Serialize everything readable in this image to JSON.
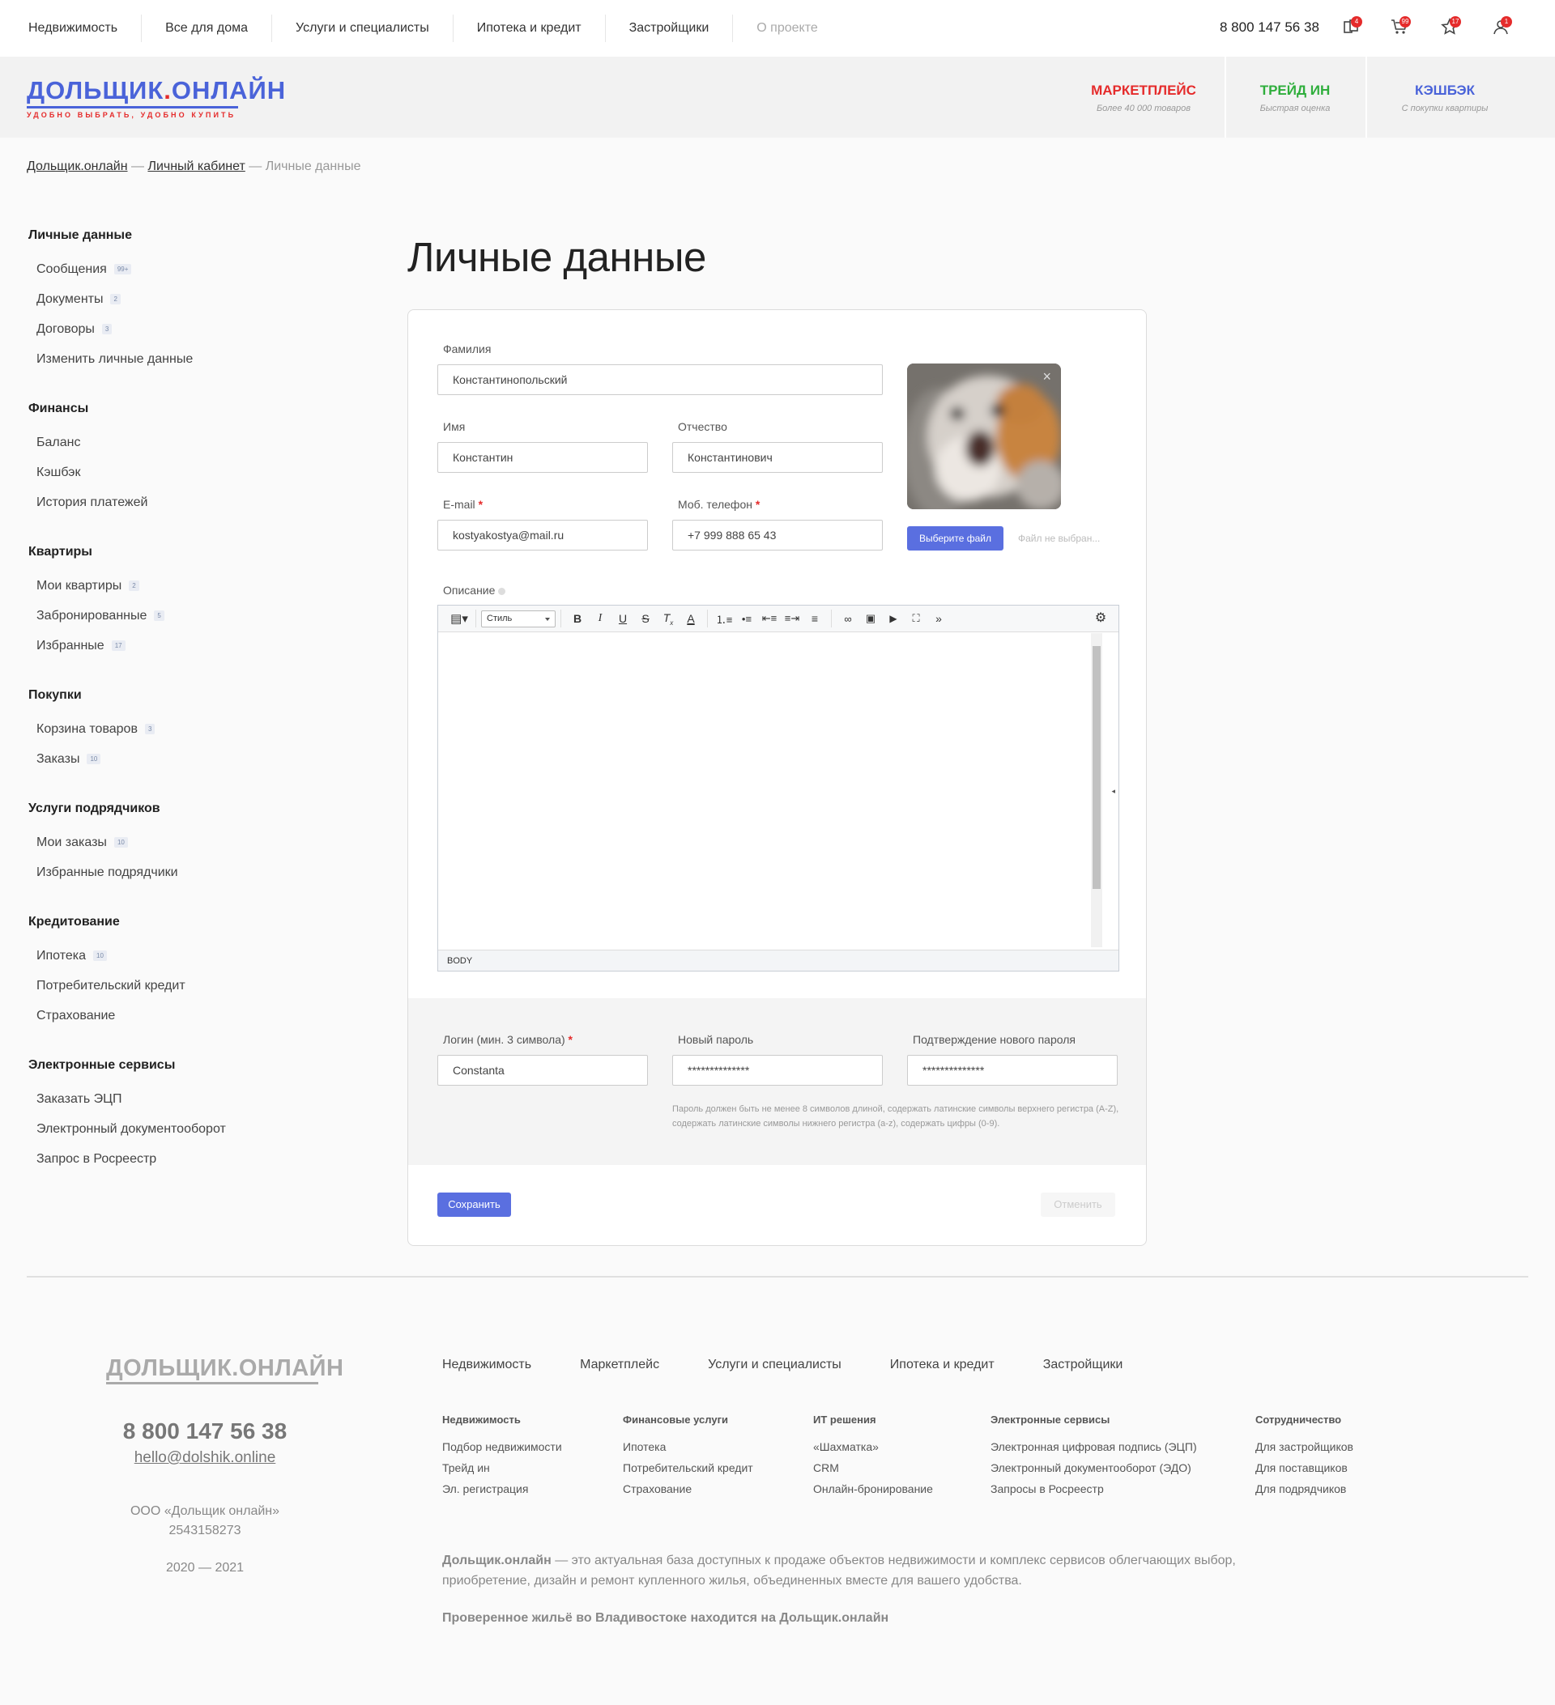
{
  "topbar": {
    "nav": [
      "Недвижимость",
      "Все для дома",
      "Услуги и специалисты",
      "Ипотека и кредит",
      "Застройщики",
      "О проекте"
    ],
    "phone": "8 800 147 56 38",
    "badges": {
      "compare": "4",
      "cart": "99",
      "favorites": "17",
      "account": "1"
    }
  },
  "header": {
    "logo_main_left": "ДОЛЬЩИК",
    "logo_dot": ".",
    "logo_main_right": "ОНЛАЙН",
    "logo_tagline": "УДОБНО ВЫБРАТЬ, УДОБНО КУПИТЬ",
    "promos": [
      {
        "title": "МАРКЕТПЛЕЙС",
        "subtitle": "Более 40 000 товаров",
        "color": "#e52b2b"
      },
      {
        "title": "ТРЕЙД ИН",
        "subtitle": "Быстрая оценка",
        "color": "#2fae3c"
      },
      {
        "title": "КЭШБЭК",
        "subtitle": "С покупки квартиры",
        "color": "#4a63d9"
      }
    ]
  },
  "breadcrumbs": {
    "home": "Дольщик.онлайн",
    "sep": "—",
    "cabinet": "Личный кабинет",
    "current": "Личные данные"
  },
  "sidebar": [
    {
      "title": "Личные данные",
      "items": [
        {
          "label": "Сообщения",
          "count": "99+"
        },
        {
          "label": "Документы",
          "count": "2"
        },
        {
          "label": "Договоры",
          "count": "3"
        },
        {
          "label": "Изменить личные данные",
          "count": ""
        }
      ]
    },
    {
      "title": "Финансы",
      "items": [
        {
          "label": "Баланс",
          "count": ""
        },
        {
          "label": "Кэшбэк",
          "count": ""
        },
        {
          "label": "История платежей",
          "count": ""
        }
      ]
    },
    {
      "title": "Квартиры",
      "items": [
        {
          "label": "Мои квартиры",
          "count": "2"
        },
        {
          "label": "Забронированные",
          "count": "5"
        },
        {
          "label": "Избранные",
          "count": "17"
        }
      ]
    },
    {
      "title": "Покупки",
      "items": [
        {
          "label": "Корзина товаров",
          "count": "3"
        },
        {
          "label": "Заказы",
          "count": "10"
        }
      ]
    },
    {
      "title": "Услуги подрядчиков",
      "items": [
        {
          "label": "Мои заказы",
          "count": "10"
        },
        {
          "label": "Избранные подрядчики",
          "count": ""
        }
      ]
    },
    {
      "title": "Кредитование",
      "items": [
        {
          "label": "Ипотека",
          "count": "10"
        },
        {
          "label": "Потребительский кредит",
          "count": ""
        },
        {
          "label": "Страхование",
          "count": ""
        }
      ]
    },
    {
      "title": "Электронные сервисы",
      "items": [
        {
          "label": "Заказать ЭЦП",
          "count": ""
        },
        {
          "label": "Электронный документооборот",
          "count": ""
        },
        {
          "label": "Запрос в Росреестр",
          "count": ""
        }
      ]
    }
  ],
  "page_title": "Личные данные",
  "form": {
    "surname_label": "Фамилия",
    "surname_value": "Константинопольский",
    "name_label": "Имя",
    "name_value": "Константин",
    "patronymic_label": "Отчество",
    "patronymic_value": "Константинович",
    "email_label": "E-mail",
    "email_value": "kostyakostya@mail.ru",
    "phone_label": "Моб. телефон",
    "phone_value": "+7 999 888 65 43",
    "required_mark": "*",
    "file_button": "Выберите файл",
    "file_status": "Файл не выбран...",
    "photo_remove": "×",
    "description_label": "Описание",
    "editor_style": "Стиль",
    "editor_status": "BODY",
    "login_label": "Логин (мин. 3 символа)",
    "login_value": "Constanta",
    "new_password_label": "Новый пароль",
    "new_password_value": "**************",
    "confirm_password_label": "Подтверждение нового пароля",
    "confirm_password_value": "**************",
    "password_hint": "Пароль должен быть не менее 8 символов длиной, содержать латинские символы верхнего регистра (A-Z), содержать латинские символы нижнего регистра (a-z), содержать цифры (0-9).",
    "save": "Сохранить",
    "cancel": "Отменить"
  },
  "editor_tools": [
    "source-icon",
    "bold-icon",
    "italic-icon",
    "underline-icon",
    "strike-icon",
    "clear-format-icon",
    "text-color-icon",
    "ordered-list-icon",
    "bullet-list-icon",
    "outdent-icon",
    "indent-icon",
    "justify-icon",
    "link-icon",
    "image-icon",
    "video-icon",
    "fullscreen-icon",
    "more-icon",
    "settings-icon"
  ],
  "footer": {
    "logo_left": "ДОЛЬЩИК",
    "logo_dot": ".",
    "logo_right": "ОНЛАЙН",
    "phone": "8 800 147 56 38",
    "email": "hello@dolshik.online",
    "org": "ООО «Дольщик онлайн»",
    "inn": "2543158273",
    "years": "2020 — 2021",
    "nav": [
      "Недвижимость",
      "Маркетплейс",
      "Услуги и специалисты",
      "Ипотека и кредит",
      "Застройщики"
    ],
    "columns": [
      {
        "title": "Недвижимость",
        "links": [
          "Подбор недвижимости",
          "Трейд ин",
          "Эл. регистрация"
        ]
      },
      {
        "title": "Финансовые услуги",
        "links": [
          "Ипотека",
          "Потребительский кредит",
          "Страхование"
        ]
      },
      {
        "title": "ИТ решения",
        "links": [
          "«Шахматка»",
          "CRM",
          "Онлайн-бронирование"
        ]
      },
      {
        "title": "Электронные сервисы",
        "links": [
          "Электронная цифровая подпись (ЭЦП)",
          "Электронный документооборот (ЭДО)",
          "Запросы в Росреестр"
        ]
      },
      {
        "title": "Сотрудничество",
        "links": [
          "Для застройщиков",
          "Для поставщиков",
          "Для подрядчиков"
        ]
      }
    ],
    "about_brand": "Дольщик.онлайн",
    "about_text": " — это актуальная база доступных к продаже объектов недвижимости и комплекс сервисов облегчающих выбор, приобретение, дизайн и ремонт купленного жилья, объединенных вместе для вашего удобства.",
    "tagline": "Проверенное жильё во Владивостоке находится на Дольщик.онлайн"
  },
  "colors": {
    "accent": "#5a6fe0",
    "brand_blue": "#4a63d9",
    "brand_red": "#e52b2b"
  }
}
